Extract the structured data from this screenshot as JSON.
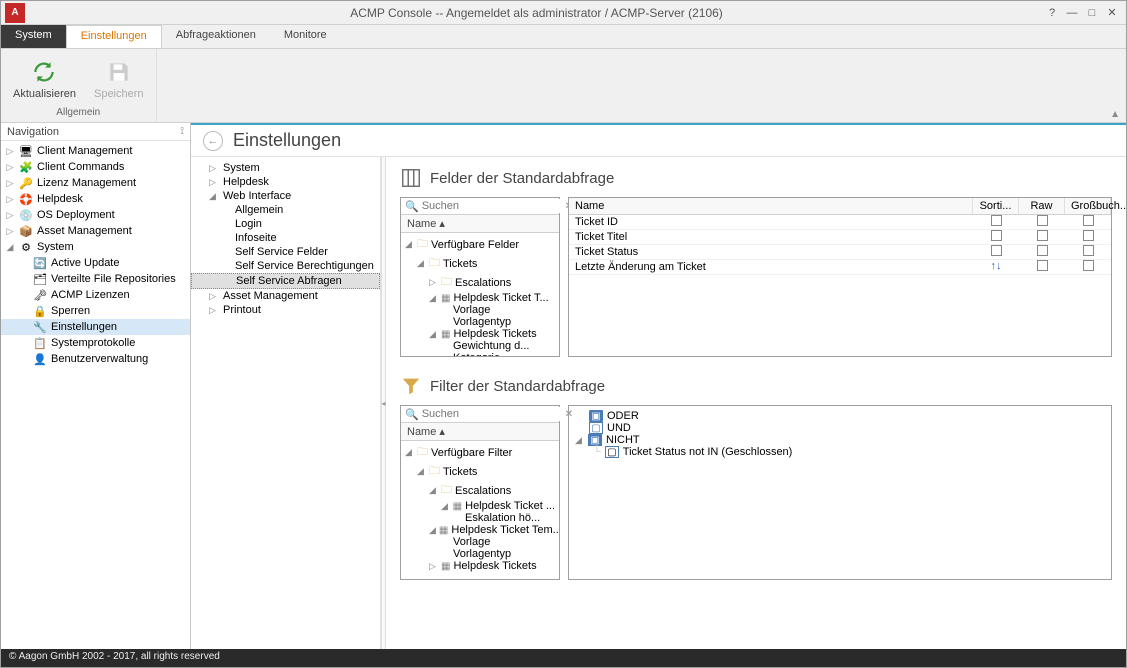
{
  "titlebar": {
    "title": "ACMP Console -- Angemeldet als administrator / ACMP-Server (2106)"
  },
  "menu": {
    "system": "System",
    "einstellungen": "Einstellungen",
    "abfrageaktionen": "Abfrageaktionen",
    "monitore": "Monitore"
  },
  "ribbon": {
    "aktualisieren": "Aktualisieren",
    "speichern": "Speichern",
    "group_allgemein": "Allgemein"
  },
  "nav": {
    "header": "Navigation",
    "items": [
      {
        "label": "Client Management",
        "toggle": "▷"
      },
      {
        "label": "Client Commands",
        "toggle": "▷"
      },
      {
        "label": "Lizenz Management",
        "toggle": "▷"
      },
      {
        "label": "Helpdesk",
        "toggle": "▷"
      },
      {
        "label": "OS Deployment",
        "toggle": "▷"
      },
      {
        "label": "Asset Management",
        "toggle": "▷"
      },
      {
        "label": "System",
        "toggle": "◢"
      }
    ],
    "system_children": [
      "Active Update",
      "Verteilte File Repositories",
      "ACMP Lizenzen",
      "Sperren",
      "Einstellungen",
      "Systemprotokolle",
      "Benutzerverwaltung"
    ]
  },
  "content": {
    "title": "Einstellungen",
    "subtree": [
      {
        "label": "System",
        "lvl": 0,
        "t": "▷"
      },
      {
        "label": "Helpdesk",
        "lvl": 0,
        "t": "▷"
      },
      {
        "label": "Web Interface",
        "lvl": 0,
        "t": "◢"
      },
      {
        "label": "Allgemein",
        "lvl": 1,
        "t": ""
      },
      {
        "label": "Login",
        "lvl": 1,
        "t": ""
      },
      {
        "label": "Infoseite",
        "lvl": 1,
        "t": ""
      },
      {
        "label": "Self Service Felder",
        "lvl": 1,
        "t": ""
      },
      {
        "label": "Self Service Berechtigungen",
        "lvl": 1,
        "t": ""
      },
      {
        "label": "Self Service Abfragen",
        "lvl": 1,
        "t": "",
        "sel": true
      },
      {
        "label": "Asset Management",
        "lvl": 0,
        "t": "▷"
      },
      {
        "label": "Printout",
        "lvl": 0,
        "t": "▷"
      }
    ]
  },
  "felder": {
    "section_title": "Felder der Standardabfrage",
    "search_placeholder": "Suchen",
    "col_name": "Name",
    "tree": [
      {
        "label": "Verfügbare Felder",
        "lvl": 0,
        "t": "◢",
        "icon": "folder"
      },
      {
        "label": "Tickets",
        "lvl": 1,
        "t": "◢",
        "icon": "folder"
      },
      {
        "label": "Escalations",
        "lvl": 2,
        "t": "▷",
        "icon": "folder"
      },
      {
        "label": "Helpdesk Ticket T...",
        "lvl": 2,
        "t": "◢",
        "icon": "table"
      },
      {
        "label": "Vorlage",
        "lvl": 3,
        "t": "",
        "icon": ""
      },
      {
        "label": "Vorlagentyp",
        "lvl": 3,
        "t": "",
        "icon": ""
      },
      {
        "label": "Helpdesk Tickets",
        "lvl": 2,
        "t": "◢",
        "icon": "table"
      },
      {
        "label": "Gewichtung d...",
        "lvl": 3,
        "t": "",
        "icon": ""
      },
      {
        "label": "Kategorie",
        "lvl": 3,
        "t": "",
        "icon": ""
      }
    ],
    "grid_headers": {
      "name": "Name",
      "sort": "Sorti...",
      "raw": "Raw",
      "gross": "Großbuch..."
    },
    "grid_rows": [
      {
        "name": "Ticket ID",
        "sort": ""
      },
      {
        "name": "Ticket Titel",
        "sort": ""
      },
      {
        "name": "Ticket Status",
        "sort": ""
      },
      {
        "name": "Letzte Änderung am Ticket",
        "sort": "↑↓"
      }
    ]
  },
  "filter": {
    "section_title": "Filter der Standardabfrage",
    "search_placeholder": "Suchen",
    "col_name": "Name",
    "tree": [
      {
        "label": "Verfügbare Filter",
        "lvl": 0,
        "t": "◢",
        "icon": "folder"
      },
      {
        "label": "Tickets",
        "lvl": 1,
        "t": "◢",
        "icon": "folder"
      },
      {
        "label": "Escalations",
        "lvl": 2,
        "t": "◢",
        "icon": "folder"
      },
      {
        "label": "Helpdesk Ticket ...",
        "lvl": 3,
        "t": "◢",
        "icon": "table"
      },
      {
        "label": "Eskalation hö...",
        "lvl": 4,
        "t": "",
        "icon": ""
      },
      {
        "label": "Helpdesk Ticket Tem...",
        "lvl": 2,
        "t": "◢",
        "icon": "table"
      },
      {
        "label": "Vorlage",
        "lvl": 3,
        "t": "",
        "icon": ""
      },
      {
        "label": "Vorlagentyp",
        "lvl": 3,
        "t": "",
        "icon": ""
      },
      {
        "label": "Helpdesk Tickets",
        "lvl": 2,
        "t": "▷",
        "icon": "table"
      }
    ],
    "ops": {
      "oder": "ODER",
      "und": "UND",
      "nicht": "NICHT",
      "leaf": "Ticket Status not IN (Geschlossen)"
    }
  },
  "footer": "© Aagon GmbH 2002 - 2017, all rights reserved"
}
